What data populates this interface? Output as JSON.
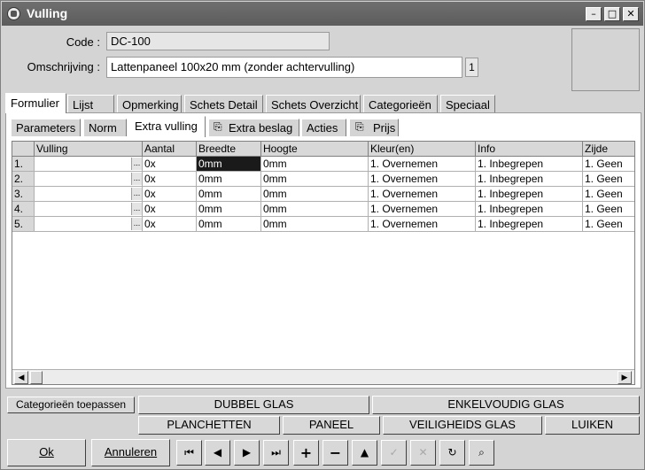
{
  "window": {
    "title": "Vulling"
  },
  "form": {
    "code_label": "Code :",
    "code_value": "DC-100",
    "omschrijving_label": "Omschrijving :",
    "omschrijving_value": "Lattenpaneel 100x20 mm (zonder achtervulling)",
    "count": "1"
  },
  "main_tabs": [
    "Formulier",
    "Lijst",
    "Opmerking",
    "Schets Detail",
    "Schets Overzicht",
    "Categorieën",
    "Speciaal"
  ],
  "sub_tabs": [
    "Parameters",
    "Norm",
    "Extra vulling",
    "Extra beslag",
    "Acties",
    "Prijs"
  ],
  "grid": {
    "columns": [
      "Vulling",
      "Aantal",
      "Breedte",
      "Hoogte",
      "Kleur(en)",
      "Info",
      "Zijde"
    ],
    "rows": [
      {
        "num": "1.",
        "vulling": "",
        "aantal": "0x",
        "breedte": "0mm",
        "hoogte": "0mm",
        "kleur": "1. Overnemen",
        "info": "1. Inbegrepen",
        "zijde": "1. Geen"
      },
      {
        "num": "2.",
        "vulling": "",
        "aantal": "0x",
        "breedte": "0mm",
        "hoogte": "0mm",
        "kleur": "1. Overnemen",
        "info": "1. Inbegrepen",
        "zijde": "1. Geen"
      },
      {
        "num": "3.",
        "vulling": "",
        "aantal": "0x",
        "breedte": "0mm",
        "hoogte": "0mm",
        "kleur": "1. Overnemen",
        "info": "1. Inbegrepen",
        "zijde": "1. Geen"
      },
      {
        "num": "4.",
        "vulling": "",
        "aantal": "0x",
        "breedte": "0mm",
        "hoogte": "0mm",
        "kleur": "1. Overnemen",
        "info": "1. Inbegrepen",
        "zijde": "1. Geen"
      },
      {
        "num": "5.",
        "vulling": "",
        "aantal": "0x",
        "breedte": "0mm",
        "hoogte": "0mm",
        "kleur": "1. Overnemen",
        "info": "1. Inbegrepen",
        "zijde": "1. Geen"
      }
    ],
    "ellipsis": "..."
  },
  "category_buttons": {
    "apply": "Categorieën toepassen",
    "dubbel_glas": "DUBBEL GLAS",
    "enkelvoudig_glas": "ENKELVOUDIG GLAS",
    "planchetten": "PLANCHETTEN",
    "paneel": "PANEEL",
    "veiligheids_glas": "VEILIGHEIDS GLAS",
    "luiken": "LUIKEN"
  },
  "footer": {
    "ok": "Ok",
    "annuleren": "Annuleren"
  }
}
